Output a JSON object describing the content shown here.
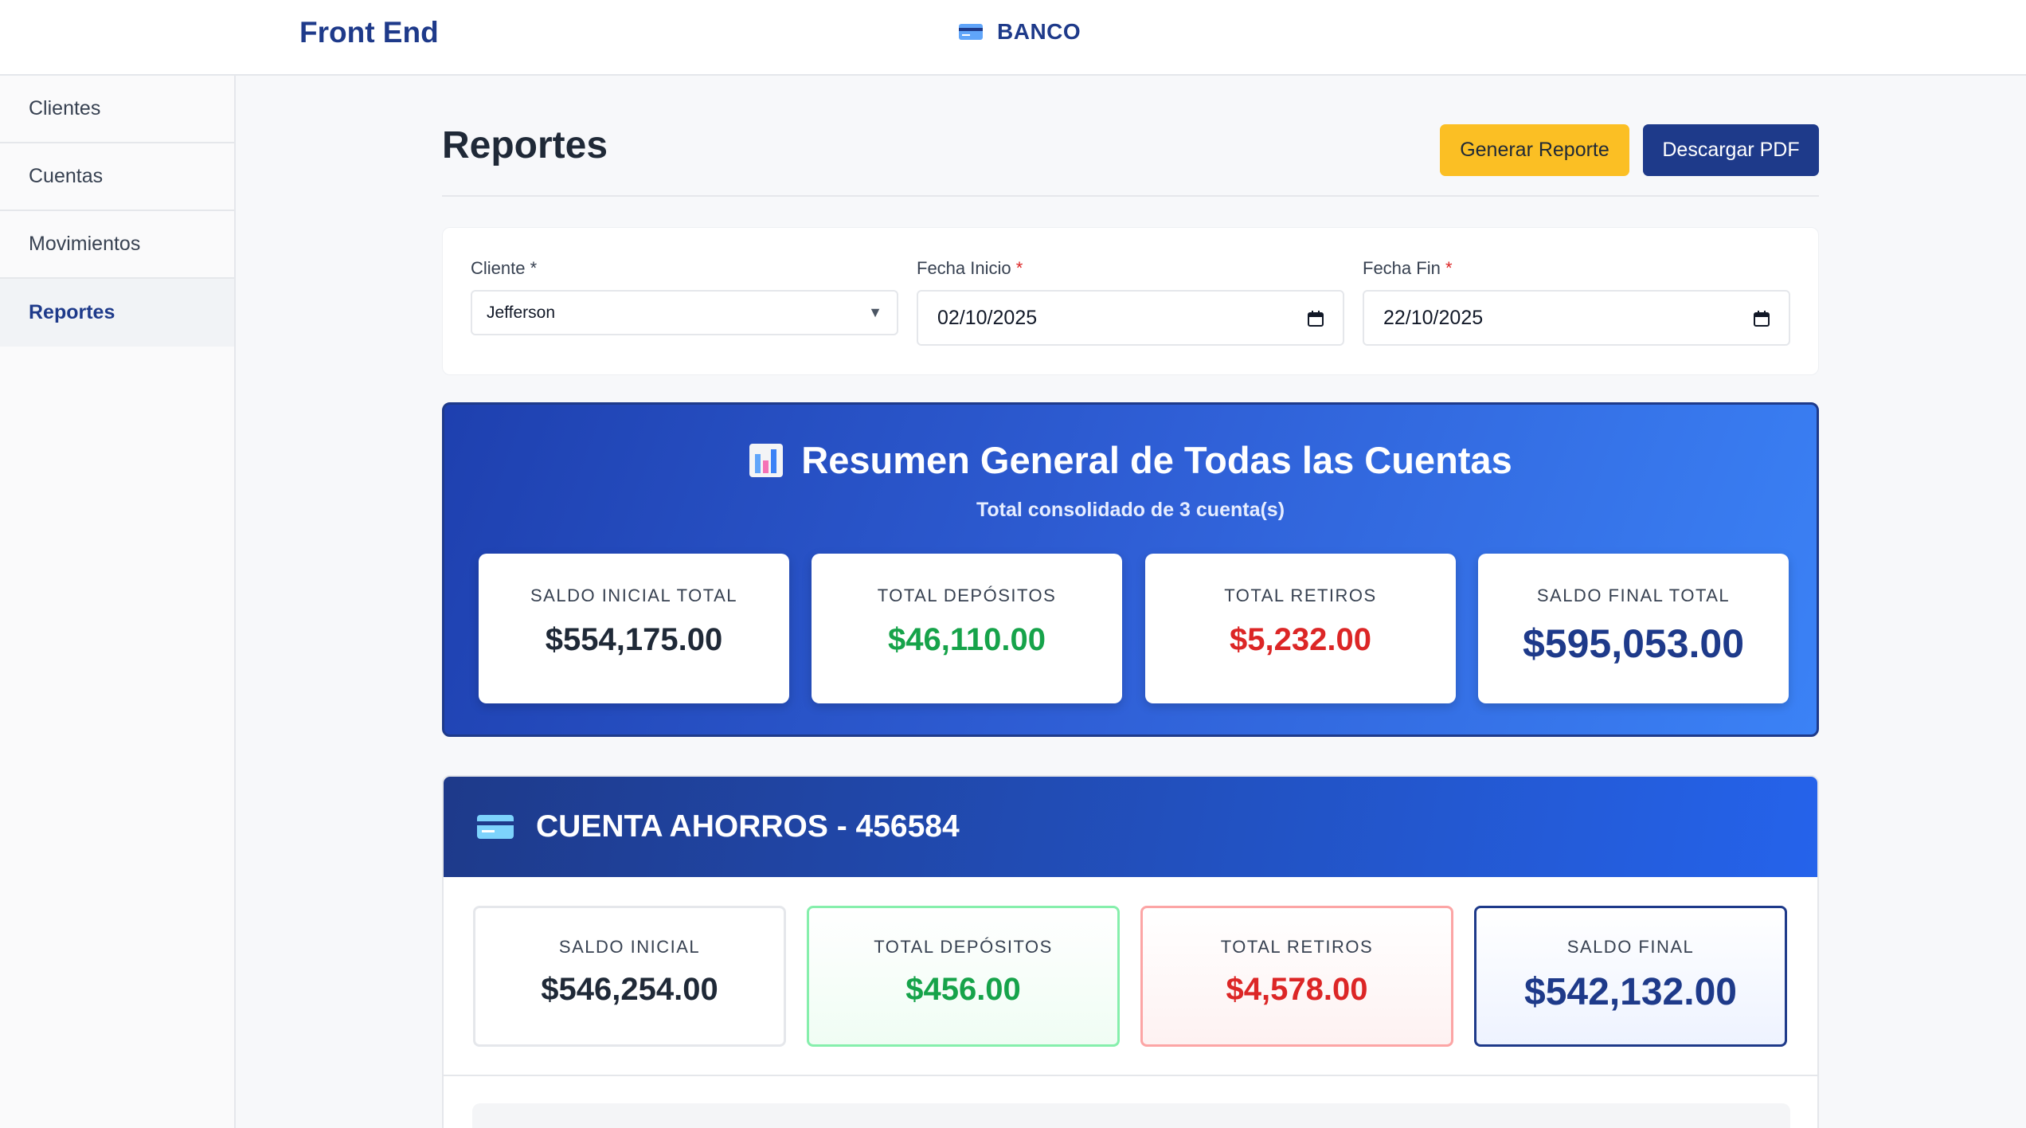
{
  "header": {
    "app_title": "Front End",
    "brand_icon": "credit-card-icon",
    "brand_text": "BANCO"
  },
  "sidebar": {
    "items": [
      {
        "label": "Clientes",
        "active": false
      },
      {
        "label": "Cuentas",
        "active": false
      },
      {
        "label": "Movimientos",
        "active": false
      },
      {
        "label": "Reportes",
        "active": true
      }
    ]
  },
  "page": {
    "title": "Reportes",
    "generate_button": "Generar Reporte",
    "pdf_button": "Descargar PDF"
  },
  "filters": {
    "client": {
      "label": "Cliente",
      "required_mark": "*",
      "value": "Jefferson"
    },
    "start_date": {
      "label": "Fecha Inicio",
      "required_mark": "*",
      "value": "02/10/2025"
    },
    "end_date": {
      "label": "Fecha Fin",
      "required_mark": "*",
      "value": "22/10/2025"
    }
  },
  "summary": {
    "icon": "bar-chart-icon",
    "title": "Resumen General de Todas las Cuentas",
    "subtitle": "Total consolidado de 3 cuenta(s)",
    "cards": [
      {
        "label": "SALDO INICIAL TOTAL",
        "value": "$554,175.00"
      },
      {
        "label": "TOTAL DEPÓSITOS",
        "value": "$46,110.00"
      },
      {
        "label": "TOTAL RETIROS",
        "value": "$5,232.00"
      },
      {
        "label": "SALDO FINAL TOTAL",
        "value": "$595,053.00"
      }
    ]
  },
  "account": {
    "icon": "credit-card-icon",
    "title": "CUENTA AHORROS - 456584",
    "cards": [
      {
        "label": "SALDO INICIAL",
        "value": "$546,254.00"
      },
      {
        "label": "TOTAL DEPÓSITOS",
        "value": "$456.00"
      },
      {
        "label": "TOTAL RETIROS",
        "value": "$4,578.00"
      },
      {
        "label": "SALDO FINAL",
        "value": "$542,132.00"
      }
    ]
  },
  "colors": {
    "brand": "#1e3a8a",
    "accent_yellow": "#fbbf24",
    "deposit_green": "#16a34a",
    "withdraw_red": "#dc2626"
  }
}
